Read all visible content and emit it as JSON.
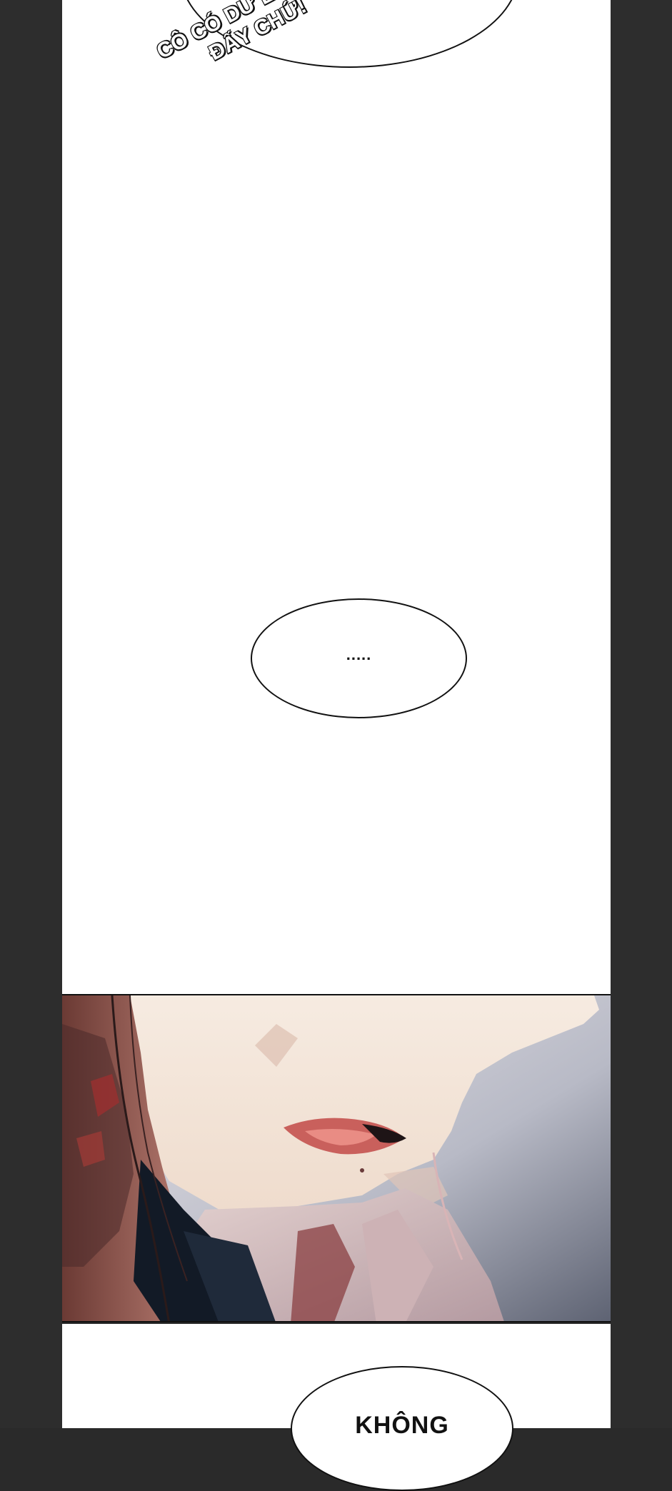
{
  "page_bg": "#2d2d2d",
  "sfx": {
    "line1": "CÔ CÓ DƯ LUÔN",
    "line2": "ĐẤY CHỨ!"
  },
  "bubble_mid": {
    "text": "....."
  },
  "bubble_bottom": {
    "text": "KHÔNG"
  },
  "panel": {
    "description_icon": "face-closeup-illustration"
  }
}
